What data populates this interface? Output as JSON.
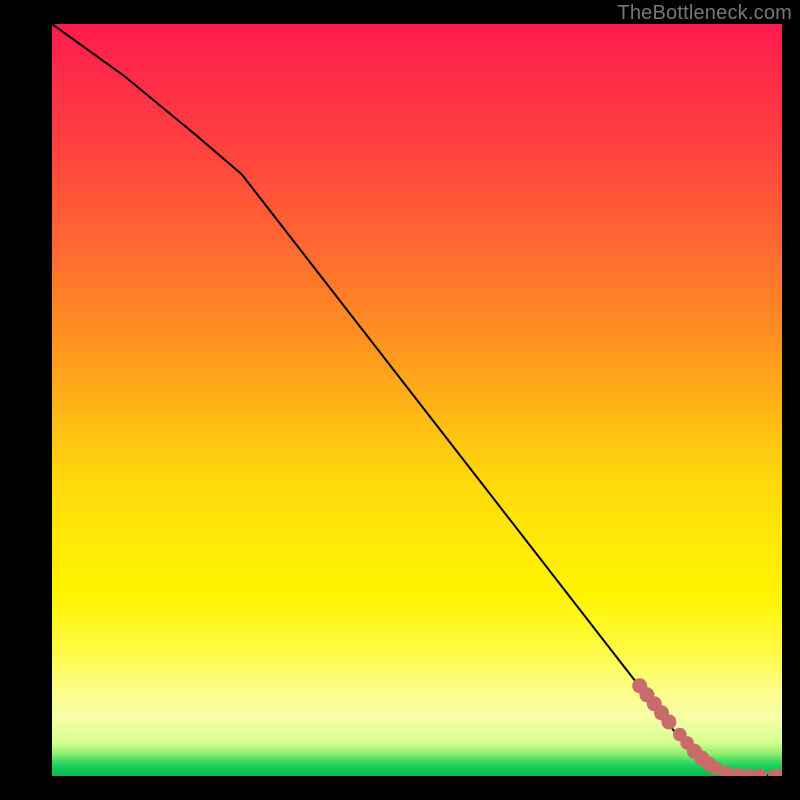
{
  "attribution": "TheBottleneck.com",
  "chart_data": {
    "type": "line",
    "title": "",
    "xlabel": "",
    "ylabel": "",
    "xlim": [
      0,
      100
    ],
    "ylim": [
      0,
      100
    ],
    "grid": false,
    "legend": false,
    "series": [
      {
        "name": "curve",
        "x": [
          0,
          10,
          20,
          26,
          30,
          40,
          50,
          60,
          70,
          80,
          84,
          86,
          88,
          90,
          92,
          94,
          96,
          98,
          100
        ],
        "y": [
          100,
          93,
          85,
          80,
          75,
          62.5,
          50,
          37.5,
          25,
          12.5,
          7.5,
          5,
          3,
          1.5,
          0.7,
          0.3,
          0.1,
          0.05,
          0
        ]
      }
    ],
    "markers": {
      "name": "highlighted-points",
      "color": "#c96b6b",
      "points": [
        {
          "x": 80.5,
          "y": 12.0,
          "r": 1.0
        },
        {
          "x": 81.5,
          "y": 10.8,
          "r": 1.0
        },
        {
          "x": 82.5,
          "y": 9.6,
          "r": 1.0
        },
        {
          "x": 83.5,
          "y": 8.4,
          "r": 1.0
        },
        {
          "x": 84.5,
          "y": 7.2,
          "r": 1.0
        },
        {
          "x": 86.0,
          "y": 5.5,
          "r": 0.9
        },
        {
          "x": 87.0,
          "y": 4.4,
          "r": 0.9
        },
        {
          "x": 88.0,
          "y": 3.3,
          "r": 1.0
        },
        {
          "x": 89.0,
          "y": 2.4,
          "r": 1.0
        },
        {
          "x": 90.0,
          "y": 1.6,
          "r": 1.0
        },
        {
          "x": 91.0,
          "y": 1.0,
          "r": 0.9
        },
        {
          "x": 92.5,
          "y": 0.4,
          "r": 0.9
        },
        {
          "x": 94.0,
          "y": 0.15,
          "r": 0.9
        },
        {
          "x": 95.5,
          "y": 0.08,
          "r": 0.9
        },
        {
          "x": 97.0,
          "y": 0.05,
          "r": 0.9
        },
        {
          "x": 99.0,
          "y": 0.02,
          "r": 0.9
        },
        {
          "x": 100.0,
          "y": 0.0,
          "r": 0.9
        }
      ]
    },
    "background_gradient": {
      "orientation": "vertical",
      "stops": [
        {
          "pos": 0.0,
          "color": "#ff1a4d"
        },
        {
          "pos": 0.3,
          "color": "#ff6a30"
        },
        {
          "pos": 0.55,
          "color": "#ffd000"
        },
        {
          "pos": 0.82,
          "color": "#fff200"
        },
        {
          "pos": 0.95,
          "color": "#d8ff90"
        },
        {
          "pos": 0.99,
          "color": "#18c858"
        },
        {
          "pos": 1.0,
          "color": "#0bb850"
        }
      ]
    }
  }
}
